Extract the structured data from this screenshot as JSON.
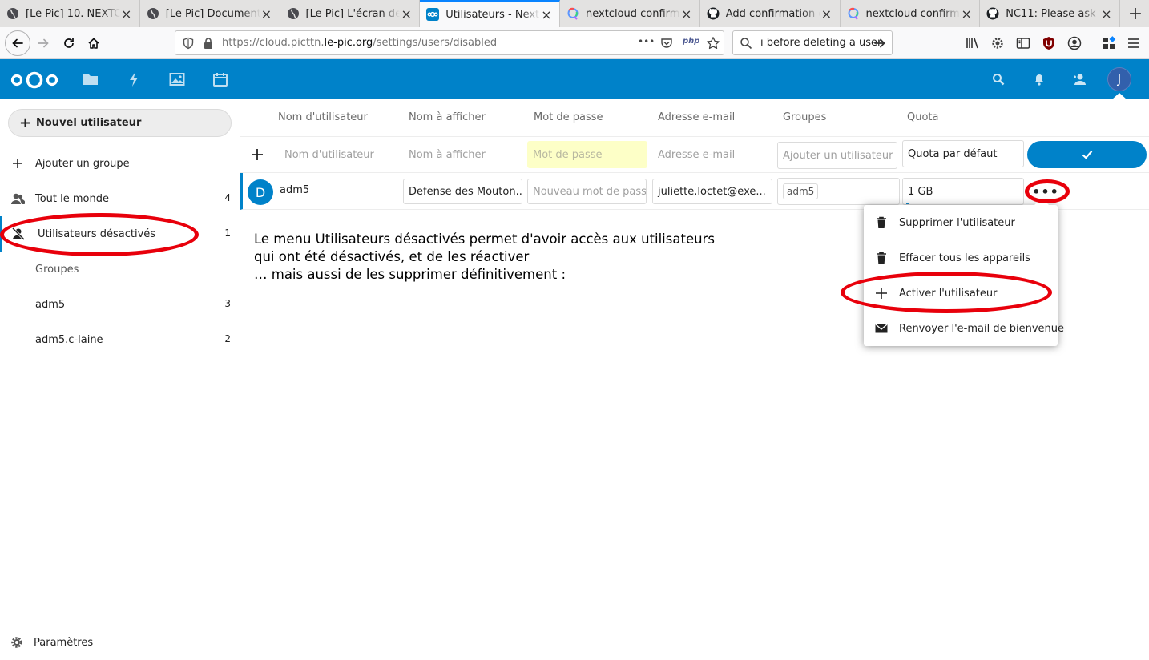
{
  "browser": {
    "tabs": [
      {
        "title": "[Le Pic] 10. NEXTCLOUD",
        "icon": "globe-icon",
        "active": false
      },
      {
        "title": "[Le Pic] Documentation",
        "icon": "globe-icon",
        "active": false
      },
      {
        "title": "[Le Pic] L'écran de connexion",
        "icon": "globe-icon",
        "active": false
      },
      {
        "title": "Utilisateurs - Nextcloud",
        "icon": "nextcloud-icon",
        "active": true
      },
      {
        "title": "nextcloud confirmation",
        "icon": "qwant-icon",
        "active": false
      },
      {
        "title": "Add confirmation dialog",
        "icon": "github-icon",
        "active": false
      },
      {
        "title": "nextcloud confirmation",
        "icon": "qwant-icon",
        "active": false
      },
      {
        "title": "NC11: Please ask for confirmation",
        "icon": "github-icon",
        "active": false
      }
    ],
    "tab_close": "×",
    "new_tab": "+",
    "url_prefix": "https://cloud.picttn.",
    "url_domain": "le-pic.org",
    "url_path": "/settings/users/disabled",
    "url_more": "•••",
    "php_badge": "php",
    "search_value": "ı before deleting a user"
  },
  "nextcloud": {
    "header_color": "#0082c9",
    "avatar_letter": "J"
  },
  "sidebar": {
    "new_user": "Nouvel utilisateur",
    "add_group": "Ajouter un groupe",
    "items": [
      {
        "label": "Tout le monde",
        "count": "4"
      },
      {
        "label": "Utilisateurs désactivés",
        "count": "1"
      },
      {
        "label": "Groupes",
        "count": ""
      },
      {
        "label": "adm5",
        "count": "3"
      },
      {
        "label": "adm5.c-laine",
        "count": "2"
      }
    ],
    "settings": "Paramètres"
  },
  "table": {
    "headers": [
      "Nom d'utilisateur",
      "Nom à afficher",
      "Mot de passe",
      "Adresse e-mail",
      "Groupes",
      "Quota"
    ],
    "new_row": {
      "username_ph": "Nom d'utilisateur",
      "display_ph": "Nom à afficher",
      "password_ph": "Mot de passe",
      "email_ph": "Adresse e-mail",
      "groups_ph": "Ajouter un utilisateur au groupe",
      "quota_value": "Quota par défaut"
    },
    "user": {
      "avatar_letter": "D",
      "username": "adm5",
      "display_name": "Defense des Mouton...",
      "password_ph": "Nouveau mot de passe",
      "email": "juliette.loctet@exe...",
      "group": "adm5",
      "quota": "1 GB",
      "more": "•••"
    }
  },
  "note": "Le menu Utilisateurs désactivés permet d'avoir accès aux utilisateurs\nqui ont été désactivés, et de les réactiver\n… mais aussi de les supprimer définitivement :",
  "menu": {
    "items": [
      {
        "label": "Supprimer l'utilisateur",
        "icon": "trash-icon"
      },
      {
        "label": "Effacer tous les appareils",
        "icon": "trash-icon"
      },
      {
        "label": "Activer l'utilisateur",
        "icon": "plus-icon"
      },
      {
        "label": "Renvoyer l'e-mail de bienvenue",
        "icon": "mail-icon"
      }
    ]
  },
  "annotation_color": "#e8000b"
}
